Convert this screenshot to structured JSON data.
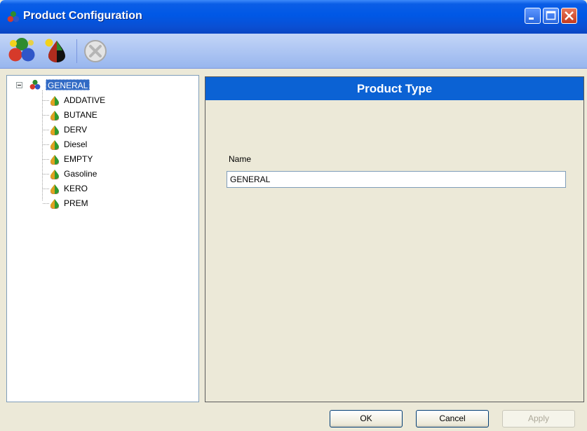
{
  "window": {
    "title": "Product Configuration",
    "accent_color": "#0058e6",
    "controls": [
      "minimize-icon",
      "maximize-icon",
      "close-icon"
    ]
  },
  "toolbar": {
    "buttons": [
      {
        "icon": "product-group-icon",
        "enabled": true
      },
      {
        "icon": "product-drop-icon",
        "enabled": true
      },
      {
        "icon": "delete-icon",
        "enabled": false
      }
    ]
  },
  "tree": {
    "root": {
      "label": "GENERAL",
      "icon": "product-group-icon",
      "expanded": true,
      "selected": true
    },
    "items": [
      {
        "label": "ADDATIVE",
        "icon": "product-drop-icon"
      },
      {
        "label": "BUTANE",
        "icon": "product-drop-icon"
      },
      {
        "label": "DERV",
        "icon": "product-drop-icon"
      },
      {
        "label": "Diesel",
        "icon": "product-drop-icon"
      },
      {
        "label": "EMPTY",
        "icon": "product-drop-icon"
      },
      {
        "label": "Gasoline",
        "icon": "product-drop-icon"
      },
      {
        "label": "KERO",
        "icon": "product-drop-icon"
      },
      {
        "label": "PREM",
        "icon": "product-drop-icon"
      }
    ]
  },
  "panel": {
    "header": "Product Type",
    "header_color": "#0b62d4",
    "name_label": "Name",
    "name_value": "GENERAL"
  },
  "buttons": {
    "ok": "OK",
    "cancel": "Cancel",
    "apply": "Apply"
  }
}
